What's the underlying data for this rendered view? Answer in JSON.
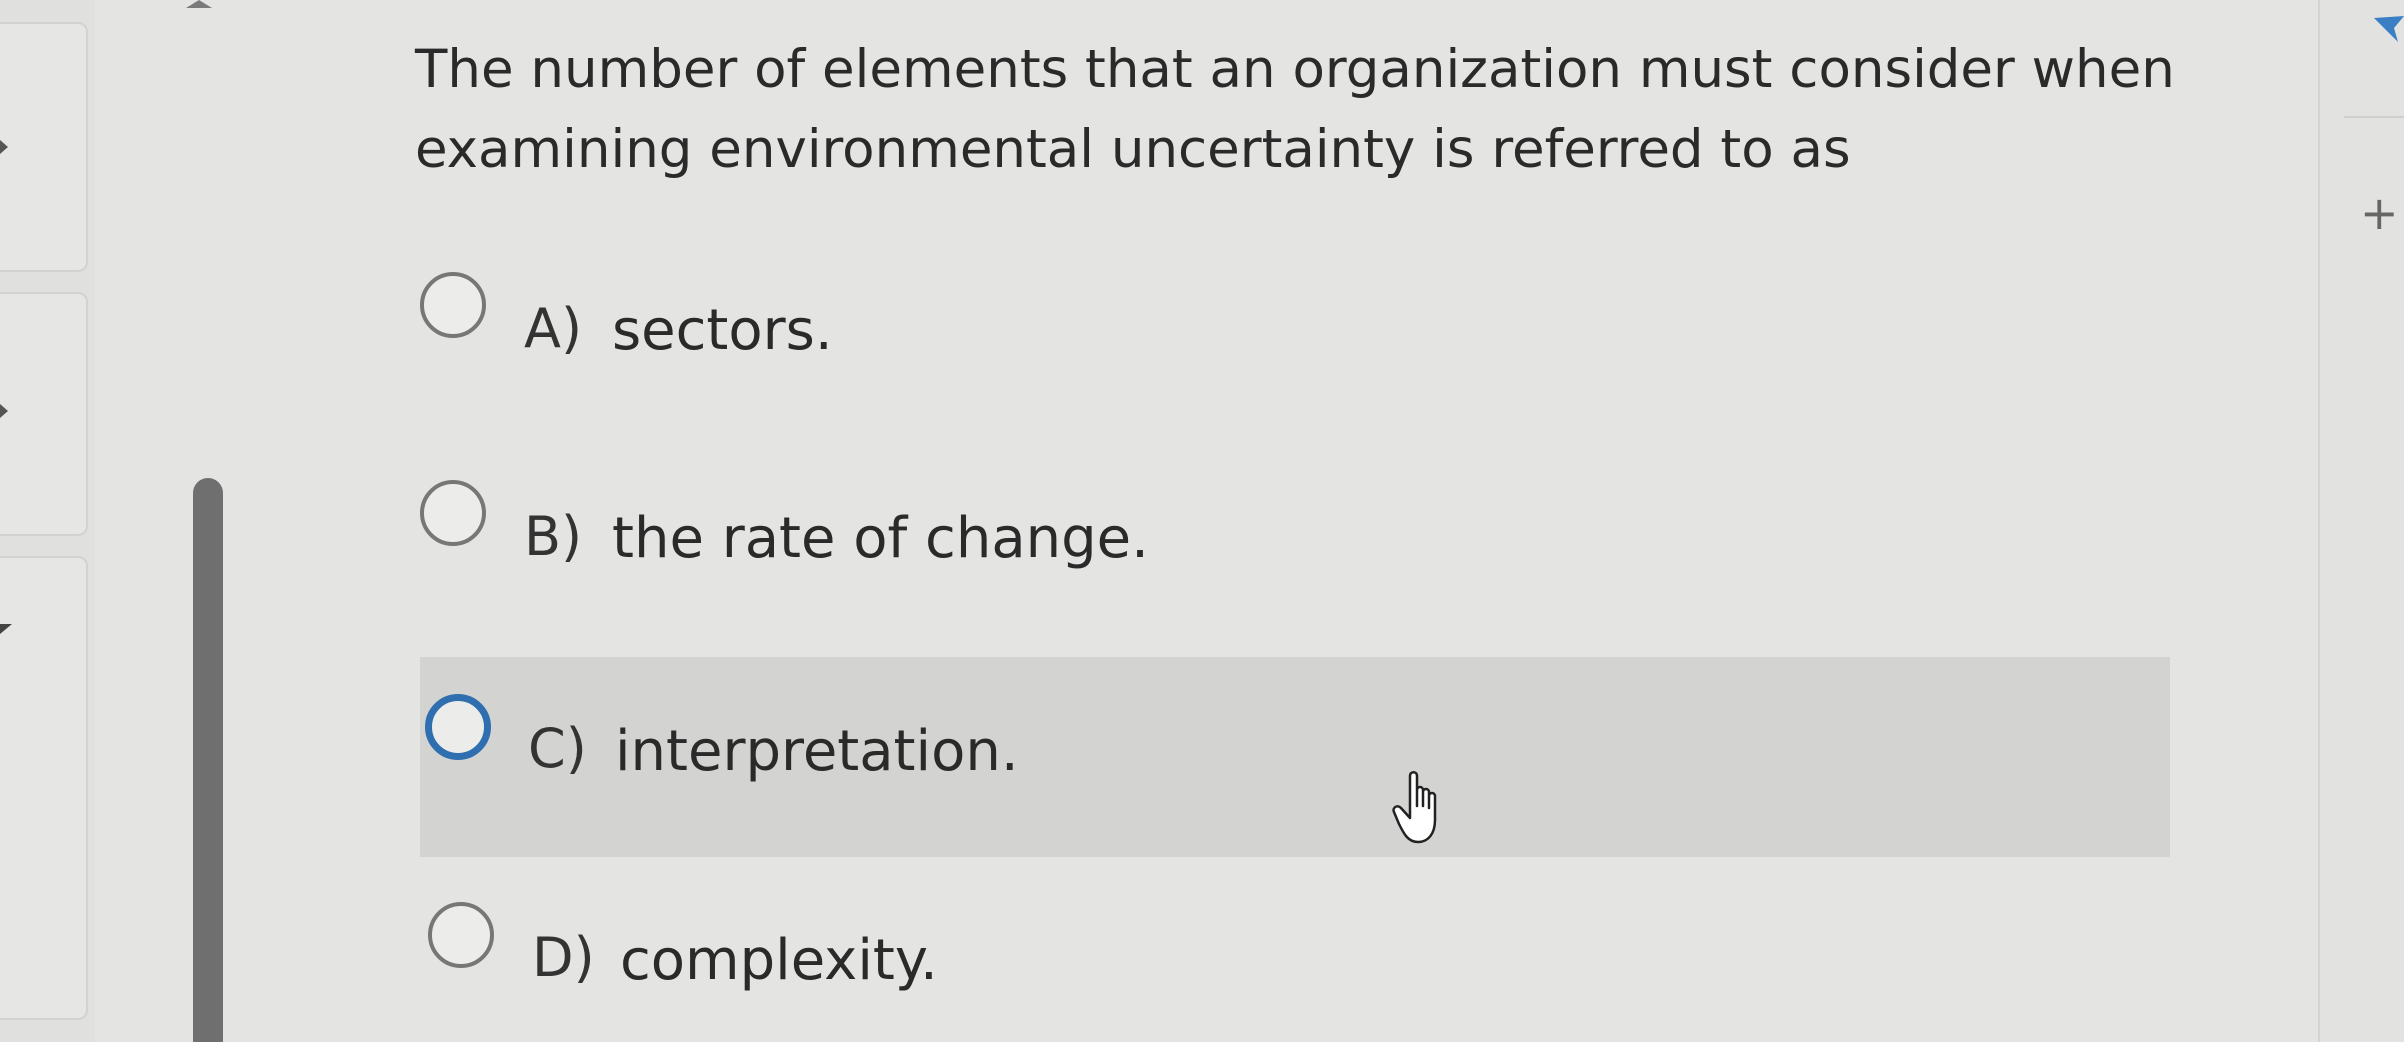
{
  "question": {
    "text": "The number of elements that an organization must consider when examining environmental uncertainty is referred to as"
  },
  "options": [
    {
      "letter": "A)",
      "text": "sectors.",
      "selected": false,
      "hovered": false
    },
    {
      "letter": "B)",
      "text": "the rate of change.",
      "selected": false,
      "hovered": false
    },
    {
      "letter": "C)",
      "text": "interpretation.",
      "selected": false,
      "hovered": true
    },
    {
      "letter": "D)",
      "text": "complexity.",
      "selected": false,
      "hovered": false
    }
  ],
  "right_rail": {
    "flag_icon": "flag-icon",
    "add_icon": "+"
  },
  "colors": {
    "background": "#e4e4e2",
    "hover_row": "#d3d3d1",
    "focus_ring": "#2f6fb0",
    "flag": "#3a7fc4"
  }
}
